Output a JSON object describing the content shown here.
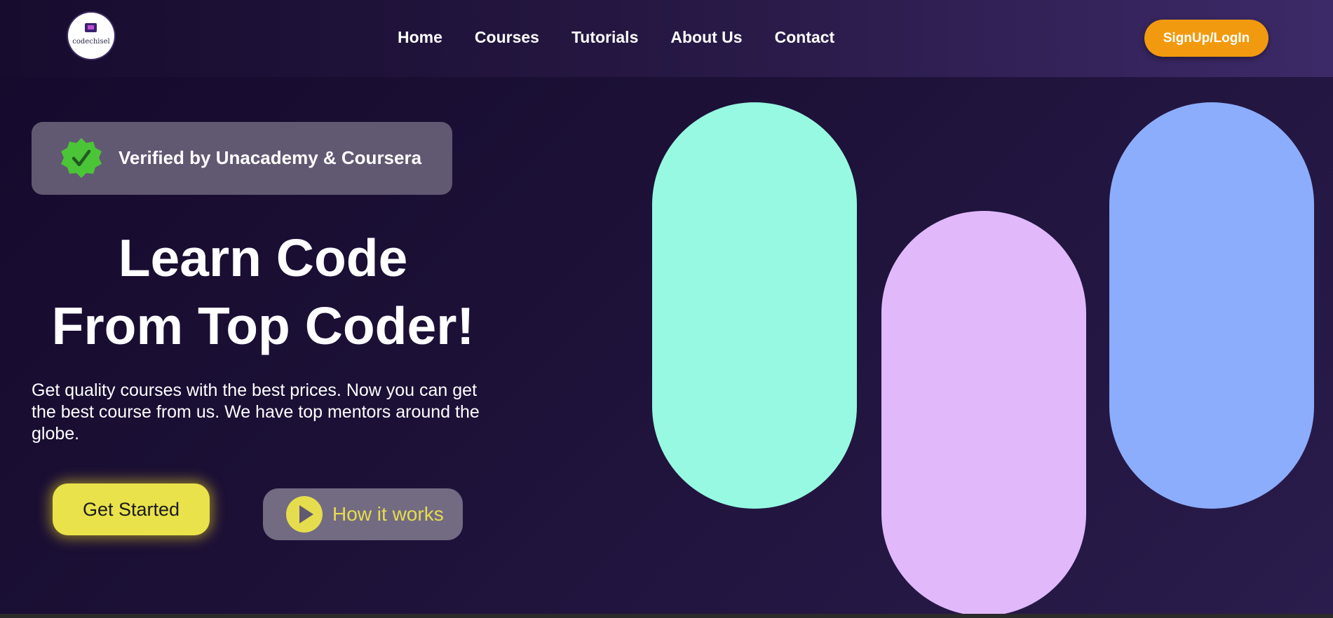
{
  "header": {
    "logo_text": "codechisel",
    "nav": [
      "Home",
      "Courses",
      "Tutorials",
      "About Us",
      "Contact"
    ],
    "signup_label": "SignUp/LogIn"
  },
  "hero": {
    "verified_text": "Verified by Unacademy & Coursera",
    "headline_line1": "Learn Code",
    "headline_line2": "From Top Coder!",
    "subtext": "Get quality courses with the best prices. Now you can get the best course from us. We have top mentors around the globe.",
    "get_started_label": "Get Started",
    "how_it_works_label": "How it works"
  },
  "icons": {
    "verified": "verified-badge-icon",
    "play": "play-icon"
  },
  "colors": {
    "accent_orange": "#f29a0f",
    "accent_yellow": "#e9e24a",
    "verified_green": "#4cc437",
    "pill_mint": "#97f9e2",
    "pill_lavender": "#e1b9fb",
    "pill_blue": "#8cadfb",
    "background_dark": "#1a0f33"
  }
}
